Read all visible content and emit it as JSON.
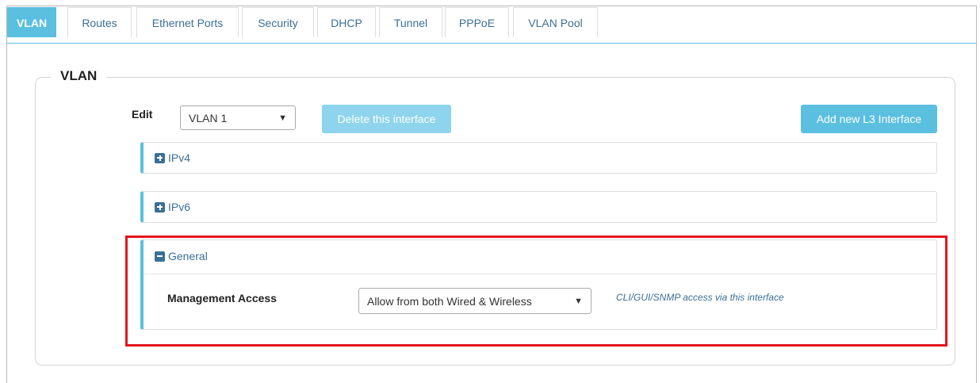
{
  "tabs": [
    {
      "label": "VLAN",
      "active": true
    },
    {
      "label": "Routes",
      "active": false
    },
    {
      "label": "Ethernet Ports",
      "active": false
    },
    {
      "label": "Security",
      "active": false
    },
    {
      "label": "DHCP",
      "active": false
    },
    {
      "label": "Tunnel",
      "active": false
    },
    {
      "label": "PPPoE",
      "active": false
    },
    {
      "label": "VLAN Pool",
      "active": false
    }
  ],
  "section": {
    "title": "VLAN"
  },
  "edit": {
    "label": "Edit",
    "selected": "VLAN 1"
  },
  "buttons": {
    "delete": "Delete this interface",
    "add": "Add new L3 Interface"
  },
  "panels": {
    "ipv4": {
      "title": "IPv4",
      "icon": "plus-square-icon"
    },
    "ipv6": {
      "title": "IPv6",
      "icon": "plus-square-icon"
    },
    "general": {
      "title": "General",
      "icon": "minus-square-icon",
      "management_access_label": "Management Access",
      "management_access_value": "Allow from both Wired & Wireless",
      "hint": "CLI/GUI/SNMP access via this interface"
    }
  },
  "colors": {
    "accent": "#5bbfe0",
    "link": "#3a6f96",
    "highlight": "#e3151c"
  }
}
